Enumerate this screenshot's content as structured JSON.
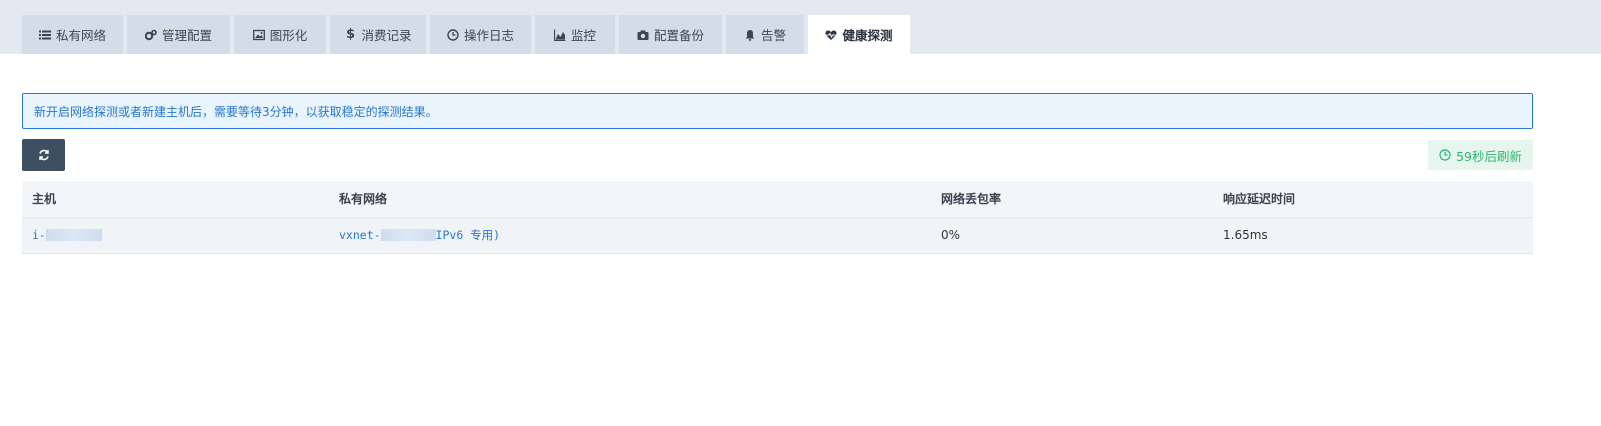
{
  "tabs": [
    {
      "label": "私有网络",
      "icon": "list-icon"
    },
    {
      "label": "管理配置",
      "icon": "cogs-icon"
    },
    {
      "label": "图形化",
      "icon": "image-icon"
    },
    {
      "label": "消费记录",
      "icon": "dollar-icon"
    },
    {
      "label": "操作日志",
      "icon": "clock-icon"
    },
    {
      "label": "监控",
      "icon": "area-chart-icon"
    },
    {
      "label": "配置备份",
      "icon": "camera-icon"
    },
    {
      "label": "告警",
      "icon": "bell-icon"
    },
    {
      "label": "健康探测",
      "icon": "heartbeat-icon",
      "active": true
    }
  ],
  "notice": {
    "text": "新开启网络探测或者新建主机后，需要等待3分钟，以获取稳定的探测结果。"
  },
  "refresh_button": {
    "icon": "refresh-icon"
  },
  "countdown": {
    "text": "59秒后刷新",
    "icon": "clock-icon"
  },
  "table": {
    "columns": [
      "主机",
      "私有网络",
      "网络丢包率",
      "响应延迟时间"
    ],
    "rows": [
      {
        "host": "i-",
        "vxnet_prefix": "vxnet-",
        "vxnet_suffix": "IPv6 专用)",
        "packet_loss": "0%",
        "latency": "1.65ms"
      }
    ]
  },
  "colors": {
    "tabbar_bg": "#e2e9f0",
    "tab_bg": "#d3dde7",
    "accent_blue": "#2777cc",
    "button_dark": "#3e4f62",
    "success_green": "#2bb673"
  }
}
